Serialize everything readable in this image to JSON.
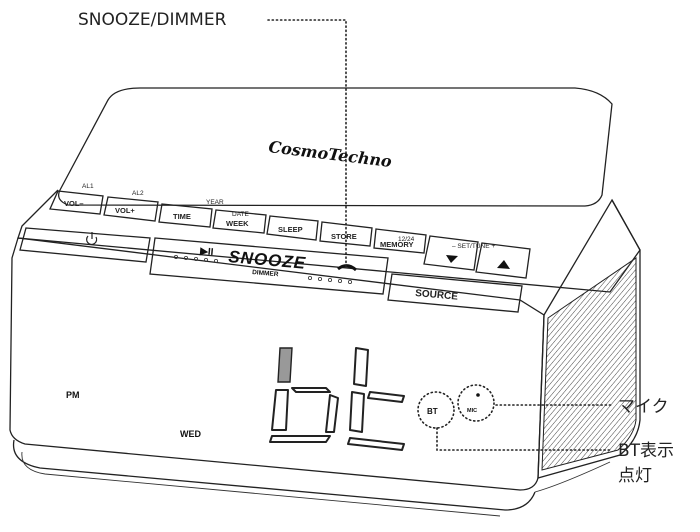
{
  "annotations": {
    "snooze_dimmer": "SNOOZE/DIMMER",
    "mic": "マイク",
    "bt_line1": "BT表示",
    "bt_line2": "点灯"
  },
  "device": {
    "brand": "CosmoTechno",
    "display_text": "bt",
    "indicators": {
      "pm": "PM",
      "day": "WED",
      "bt": "BT",
      "mic": "MIC"
    },
    "snooze_bar": {
      "label": "SNOOZE",
      "sublabel": "DIMMER",
      "play_pause": "▶II"
    },
    "keys": {
      "al1": "AL1",
      "al2": "AL2",
      "vol_minus": "VOL–",
      "vol_plus": "VOL+",
      "year": "YEAR",
      "date": "DATE",
      "time": "TIME",
      "week": "WEEK",
      "sleep": "SLEEP",
      "store": "STORE",
      "hour_mode": "12/24",
      "memory": "MEMORY",
      "set_tune": "– SET/TUNE +",
      "source": "SOURCE"
    }
  }
}
